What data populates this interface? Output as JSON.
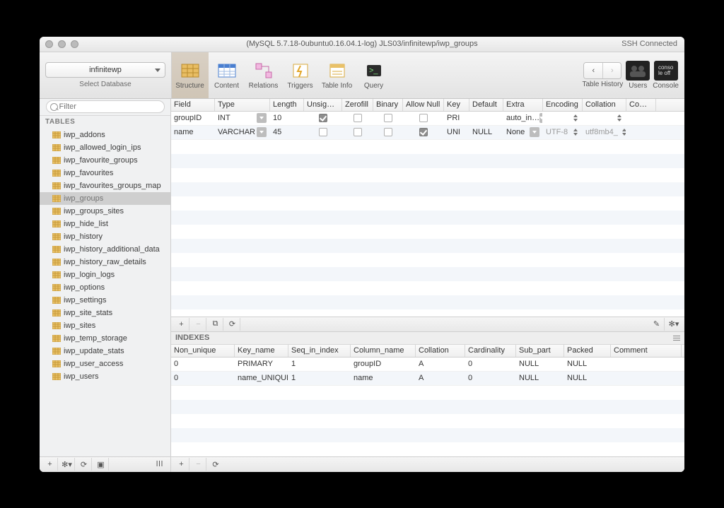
{
  "titlebar": {
    "title": "(MySQL 5.7.18-0ubuntu0.16.04.1-log) JLS03/infinitewp/iwp_groups",
    "ssh": "SSH Connected"
  },
  "db_selector": {
    "value": "infinitewp",
    "label": "Select Database"
  },
  "toolbar": {
    "structure": "Structure",
    "content": "Content",
    "relations": "Relations",
    "triggers": "Triggers",
    "table_info": "Table Info",
    "query": "Query",
    "table_history": "Table History",
    "users": "Users",
    "console": "Console"
  },
  "sidebar": {
    "filter_placeholder": "Filter",
    "section": "TABLES",
    "tables": [
      "iwp_addons",
      "iwp_allowed_login_ips",
      "iwp_favourite_groups",
      "iwp_favourites",
      "iwp_favourites_groups_map",
      "iwp_groups",
      "iwp_groups_sites",
      "iwp_hide_list",
      "iwp_history",
      "iwp_history_additional_data",
      "iwp_history_raw_details",
      "iwp_login_logs",
      "iwp_options",
      "iwp_settings",
      "iwp_site_stats",
      "iwp_sites",
      "iwp_temp_storage",
      "iwp_update_stats",
      "iwp_user_access",
      "iwp_users"
    ],
    "selected": "iwp_groups"
  },
  "columns_grid": {
    "headers": [
      "Field",
      "Type",
      "Length",
      "Unsigned",
      "Zerofill",
      "Binary",
      "Allow Null",
      "Key",
      "Default",
      "Extra",
      "Encoding",
      "Collation",
      "Comm…"
    ],
    "rows": [
      {
        "field": "groupID",
        "type": "INT",
        "length": "10",
        "unsigned": true,
        "zerofill": false,
        "binary": false,
        "allow_null": false,
        "key": "PRI",
        "default": "",
        "extra": "auto_in…",
        "encoding": "",
        "collation": ""
      },
      {
        "field": "name",
        "type": "VARCHAR",
        "length": "45",
        "unsigned": false,
        "zerofill": false,
        "binary": false,
        "allow_null": true,
        "key": "UNI",
        "default": "NULL",
        "extra": "None",
        "encoding": "UTF-8",
        "collation": "utf8mb4_"
      }
    ]
  },
  "indexes": {
    "title": "INDEXES",
    "headers": [
      "Non_unique",
      "Key_name",
      "Seq_in_index",
      "Column_name",
      "Collation",
      "Cardinality",
      "Sub_part",
      "Packed",
      "Comment"
    ],
    "rows": [
      {
        "non_unique": "0",
        "key_name": "PRIMARY",
        "seq": "1",
        "col": "groupID",
        "coll": "A",
        "card": "0",
        "sub": "NULL",
        "packed": "NULL",
        "comment": ""
      },
      {
        "non_unique": "0",
        "key_name": "name_UNIQUE",
        "seq": "1",
        "col": "name",
        "coll": "A",
        "card": "0",
        "sub": "NULL",
        "packed": "NULL",
        "comment": ""
      }
    ]
  },
  "glyphs": {
    "plus": "+",
    "minus": "−",
    "refresh": "⟳",
    "gear": "✻",
    "dup": "⧉",
    "edit": "✎",
    "pane": "▣",
    "chev_l": "‹",
    "chev_r": "›",
    "bars": "lll"
  }
}
